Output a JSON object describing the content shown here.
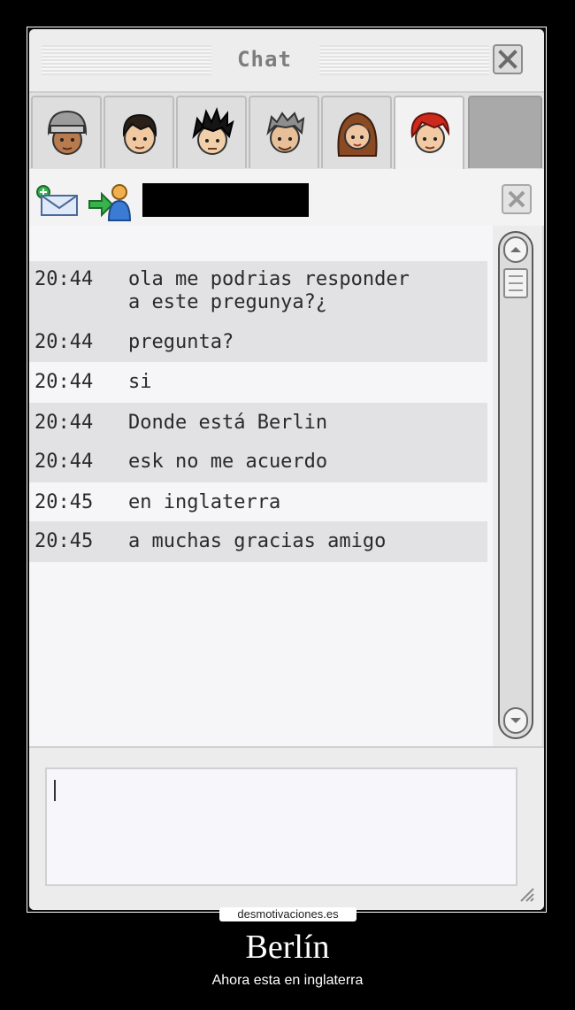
{
  "window": {
    "title": "Chat"
  },
  "tabs": [
    {
      "name": "avatar-1"
    },
    {
      "name": "avatar-2"
    },
    {
      "name": "avatar-3"
    },
    {
      "name": "avatar-4"
    },
    {
      "name": "avatar-5"
    },
    {
      "name": "avatar-6",
      "active": true
    }
  ],
  "messages": [
    {
      "time": "20:44",
      "text": "ola me podrias responder\na este pregunya?¿"
    },
    {
      "time": "20:44",
      "text": "pregunta?"
    },
    {
      "time": "20:44",
      "text": "si"
    },
    {
      "time": "20:44",
      "text": "Donde está Berlin"
    },
    {
      "time": "20:44",
      "text": "esk no me acuerdo"
    },
    {
      "time": "20:45",
      "text": "en inglaterra"
    },
    {
      "time": "20:45",
      "text": "a muchas gracias amigo"
    }
  ],
  "input": {
    "value": ""
  },
  "poster": {
    "watermark": "desmotivaciones.es",
    "title": "Berlín",
    "subtitle": "Ahora esta en inglaterra"
  },
  "colors": {
    "background": "#000000",
    "window": "#ececec",
    "shaded_row": "#e2e2e4",
    "text": "#2a2a2a"
  }
}
